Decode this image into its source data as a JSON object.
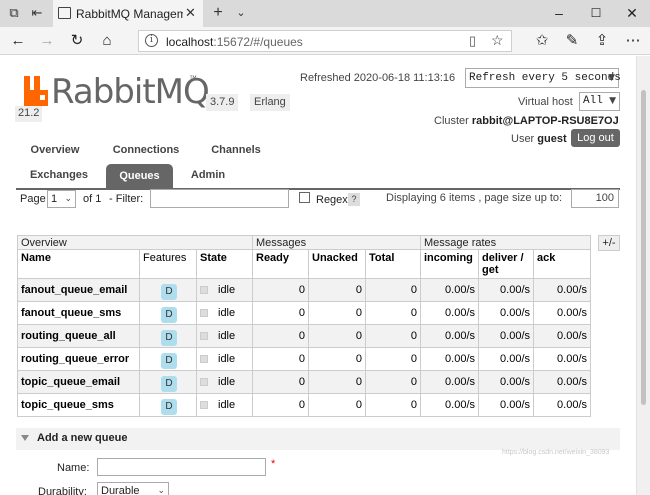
{
  "browser": {
    "tab_title": "RabbitMQ Managemen",
    "url_host": "localhost",
    "url_path": ":15672/#/queues"
  },
  "header": {
    "logo_text": "RabbitMQ",
    "version": "3.7.9",
    "erlang_label": "Erlang",
    "erlang_version": "21.2",
    "refreshed_label": "Refreshed 2020-06-18 11:13:16",
    "refresh_option": "Refresh every 5 seconds",
    "vhost_label": "Virtual host",
    "vhost_value": "All",
    "cluster_label": "Cluster",
    "cluster_name": "rabbit@LAPTOP-RSU8E7OJ",
    "user_label": "User",
    "user_name": "guest",
    "logout_label": "Log out"
  },
  "nav": {
    "tabs_row1": [
      "Overview",
      "Connections",
      "Channels"
    ],
    "tabs_row2": [
      "Exchanges",
      "Queues",
      "Admin"
    ],
    "active_tab": "Queues"
  },
  "pagination": {
    "page_label": "Page",
    "page_value": "1",
    "of_label": "of 1",
    "filter_label": "- Filter:",
    "regex_label": "Regex",
    "help_label": "?",
    "displaying_label": "Displaying 6 items , page size up to:",
    "page_size": "100"
  },
  "table": {
    "group_headers": [
      "Overview",
      "Messages",
      "Message rates"
    ],
    "plus_minus": "+/-",
    "columns": {
      "name": "Name",
      "features": "Features",
      "state": "State",
      "ready": "Ready",
      "unacked": "Unacked",
      "total": "Total",
      "incoming": "incoming",
      "deliver_get_1": "deliver /",
      "deliver_get_2": "get",
      "ack": "ack"
    },
    "rows": [
      {
        "name": "fanout_queue_email",
        "feature": "D",
        "state": "idle",
        "ready": "0",
        "unacked": "0",
        "total": "0",
        "incoming": "0.00/s",
        "deliver": "0.00/s",
        "ack": "0.00/s"
      },
      {
        "name": "fanout_queue_sms",
        "feature": "D",
        "state": "idle",
        "ready": "0",
        "unacked": "0",
        "total": "0",
        "incoming": "0.00/s",
        "deliver": "0.00/s",
        "ack": "0.00/s"
      },
      {
        "name": "routing_queue_all",
        "feature": "D",
        "state": "idle",
        "ready": "0",
        "unacked": "0",
        "total": "0",
        "incoming": "0.00/s",
        "deliver": "0.00/s",
        "ack": "0.00/s"
      },
      {
        "name": "routing_queue_error",
        "feature": "D",
        "state": "idle",
        "ready": "0",
        "unacked": "0",
        "total": "0",
        "incoming": "0.00/s",
        "deliver": "0.00/s",
        "ack": "0.00/s"
      },
      {
        "name": "topic_queue_email",
        "feature": "D",
        "state": "idle",
        "ready": "0",
        "unacked": "0",
        "total": "0",
        "incoming": "0.00/s",
        "deliver": "0.00/s",
        "ack": "0.00/s"
      },
      {
        "name": "topic_queue_sms",
        "feature": "D",
        "state": "idle",
        "ready": "0",
        "unacked": "0",
        "total": "0",
        "incoming": "0.00/s",
        "deliver": "0.00/s",
        "ack": "0.00/s"
      }
    ]
  },
  "add_queue": {
    "title": "Add a new queue",
    "name_label": "Name:",
    "required_mark": "*",
    "durability_label": "Durability:",
    "durability_value": "Durable"
  },
  "watermark": "https://blog.csdn.net/weixin_38093",
  "colors": {
    "brand_orange": "#ff6600",
    "active_tab_bg": "#666666",
    "badge_bg": "#aeddee"
  }
}
